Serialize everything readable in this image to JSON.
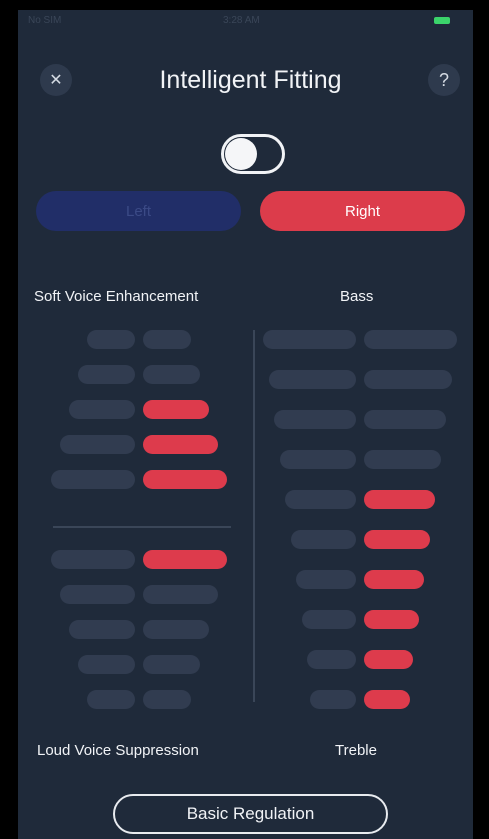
{
  "status": {
    "carrier": "No SIM",
    "time": "3:28 AM"
  },
  "header": {
    "title": "Intelligent Fitting",
    "close_glyph": "✕",
    "help_glyph": "?"
  },
  "toggle": {
    "on": false
  },
  "ear_select": {
    "left_label": "Left",
    "right_label": "Right",
    "selected": "Right"
  },
  "labels": {
    "soft_voice": "Soft Voice Enhancement",
    "bass": "Bass",
    "loud_voice": "Loud Voice Suppression",
    "treble": "Treble"
  },
  "left_panel": {
    "soft_voice_level": 3,
    "soft_voice_steps": 5,
    "loud_voice_level": 1,
    "loud_voice_steps": 5
  },
  "right_panel": {
    "bass_treble_level": 6,
    "steps": 10
  },
  "footer": {
    "basic_regulation_label": "Basic Regulation"
  },
  "colors": {
    "background": "#1f2a3a",
    "accent": "#dc3c4b",
    "inactive_bar": "#313c50",
    "left_tab": "#212e68"
  }
}
